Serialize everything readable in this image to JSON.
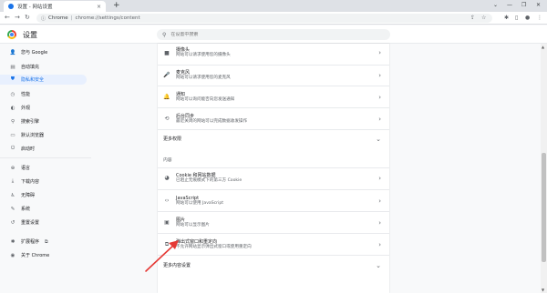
{
  "tab": {
    "title": "设置 - 网站设置",
    "close": "×",
    "new_tab": "+"
  },
  "window": {
    "chevron": "⌄",
    "minimize": "—",
    "restore": "❐",
    "close": "✕"
  },
  "toolbar": {
    "back": "←",
    "forward": "→",
    "reload": "↻",
    "site_info_icon": "ⓘ",
    "chrome_label": "Chrome",
    "separator": "|",
    "url": "chrome://settings/content"
  },
  "header": {
    "title": "设置",
    "search_placeholder": "在设置中搜索"
  },
  "sidebar": {
    "items": [
      {
        "label": "您与 Google",
        "icon": "person-icon",
        "glyph": "👤"
      },
      {
        "label": "自动填充",
        "icon": "autofill-icon",
        "glyph": "▤"
      },
      {
        "label": "隐私和安全",
        "icon": "shield-icon",
        "glyph": "⛊",
        "active": true
      },
      {
        "label": "性能",
        "icon": "performance-icon",
        "glyph": "◷"
      },
      {
        "label": "外观",
        "icon": "palette-icon",
        "glyph": "◐"
      },
      {
        "label": "搜索引擎",
        "icon": "search-icon",
        "glyph": "⚲"
      },
      {
        "label": "默认浏览器",
        "icon": "browser-icon",
        "glyph": "▭"
      },
      {
        "label": "启动时",
        "icon": "power-icon",
        "glyph": "⏻"
      },
      {
        "label": "语言",
        "icon": "globe-icon",
        "glyph": "⊕"
      },
      {
        "label": "下载内容",
        "icon": "download-icon",
        "glyph": "⤓"
      },
      {
        "label": "无障碍",
        "icon": "accessibility-icon",
        "glyph": "♿"
      },
      {
        "label": "系统",
        "icon": "wrench-icon",
        "glyph": "✎"
      },
      {
        "label": "重置设置",
        "icon": "reset-icon",
        "glyph": "↺"
      },
      {
        "label": "扩展程序",
        "icon": "extension-icon",
        "glyph": "✱",
        "external": "⧉"
      },
      {
        "label": "关于 Chrome",
        "icon": "chrome-icon",
        "glyph": "◉"
      }
    ]
  },
  "main": {
    "rows_top": [
      {
        "title": "摄像头",
        "subtitle": "网站可以请求使用您的摄像头",
        "icon": "camera-icon",
        "glyph": "■"
      },
      {
        "title": "麦克风",
        "subtitle": "网站可以请求使用您的麦克风",
        "icon": "microphone-icon",
        "glyph": "🎤"
      },
      {
        "title": "通知",
        "subtitle": "网站可以询问能否向您发送通知",
        "icon": "bell-icon",
        "glyph": "🔔"
      },
      {
        "title": "后台同步",
        "subtitle": "最近关闭的网站可以完成数据收发操作",
        "icon": "sync-icon",
        "glyph": "⟲"
      }
    ],
    "more_permissions": "更多权限",
    "content_label": "内容",
    "rows_content": [
      {
        "title": "Cookie 和网站数据",
        "subtitle": "已阻止无痕模式下的第三方 Cookie",
        "icon": "cookie-icon",
        "glyph": "◕"
      },
      {
        "title": "JavaScript",
        "subtitle": "网站可以使用 JavaScript",
        "icon": "code-icon",
        "glyph": "‹›"
      },
      {
        "title": "图片",
        "subtitle": "网站可以显示图片",
        "icon": "image-icon",
        "glyph": "▣"
      },
      {
        "title": "弹出式窗口和重定向",
        "subtitle": "不允许网站显示弹出式窗口或使用重定向",
        "icon": "popup-icon",
        "glyph": "⧉"
      }
    ],
    "more_content": "更多内容设置",
    "chevron_right": "›",
    "chevron_down": "⌄"
  },
  "colors": {
    "accent": "#1a73e8",
    "active_bg": "#e8f0fe",
    "annotation": "#e53935"
  }
}
